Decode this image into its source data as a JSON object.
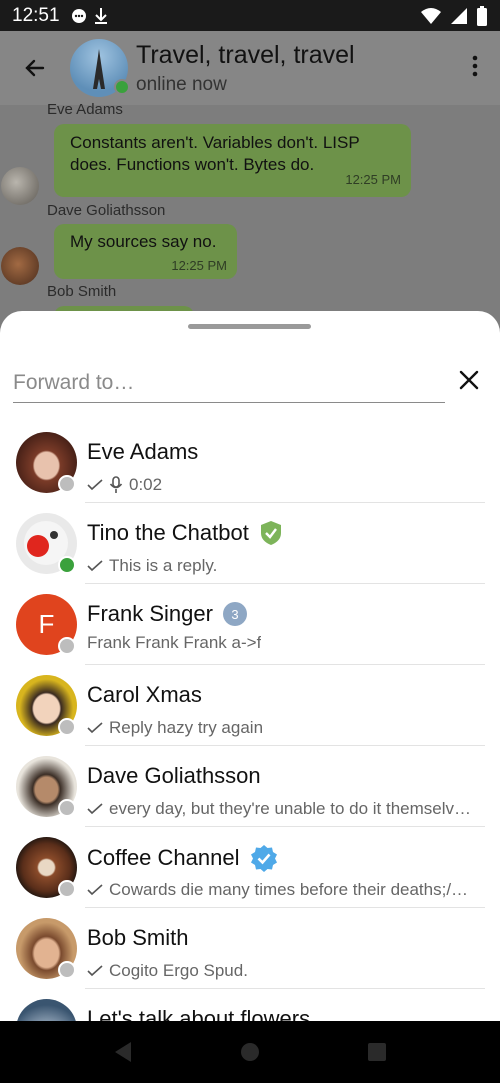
{
  "statusbar": {
    "time": "12:51"
  },
  "chat": {
    "title": "Travel, travel, travel",
    "subtitle": "online now",
    "messages": [
      {
        "sender": "Eve Adams",
        "text": "Constants aren't.  Variables don't.  LISP does.  Functions won't.  Bytes do.",
        "time": "12:25 PM"
      },
      {
        "sender": "Dave Goliathsson",
        "text": "My sources say no.",
        "time": "12:25 PM"
      },
      {
        "sender": "Bob Smith"
      }
    ]
  },
  "sheet": {
    "search_placeholder": "Forward to…",
    "contacts": [
      {
        "name": "Eve Adams",
        "sub": "0:02"
      },
      {
        "name": "Tino the Chatbot",
        "sub": "This is a reply."
      },
      {
        "name": "Frank Singer",
        "badge": "3",
        "sub": "Frank Frank Frank a->f",
        "initial": "F"
      },
      {
        "name": "Carol Xmas",
        "sub": "Reply hazy try again"
      },
      {
        "name": "Dave Goliathsson",
        "sub": "every day, but they're unable to do it themselv…"
      },
      {
        "name": "Coffee Channel",
        "sub": "Cowards die many times before their deaths;/…"
      },
      {
        "name": "Bob Smith",
        "sub": "Cogito Ergo Spud."
      },
      {
        "name": "Let's talk about flowers"
      }
    ]
  },
  "colors": {
    "accent_green": "#3aa13c",
    "bubble": "#6d9249",
    "verified_blue": "#4fa9e8",
    "badge": "#8ea7c4"
  }
}
